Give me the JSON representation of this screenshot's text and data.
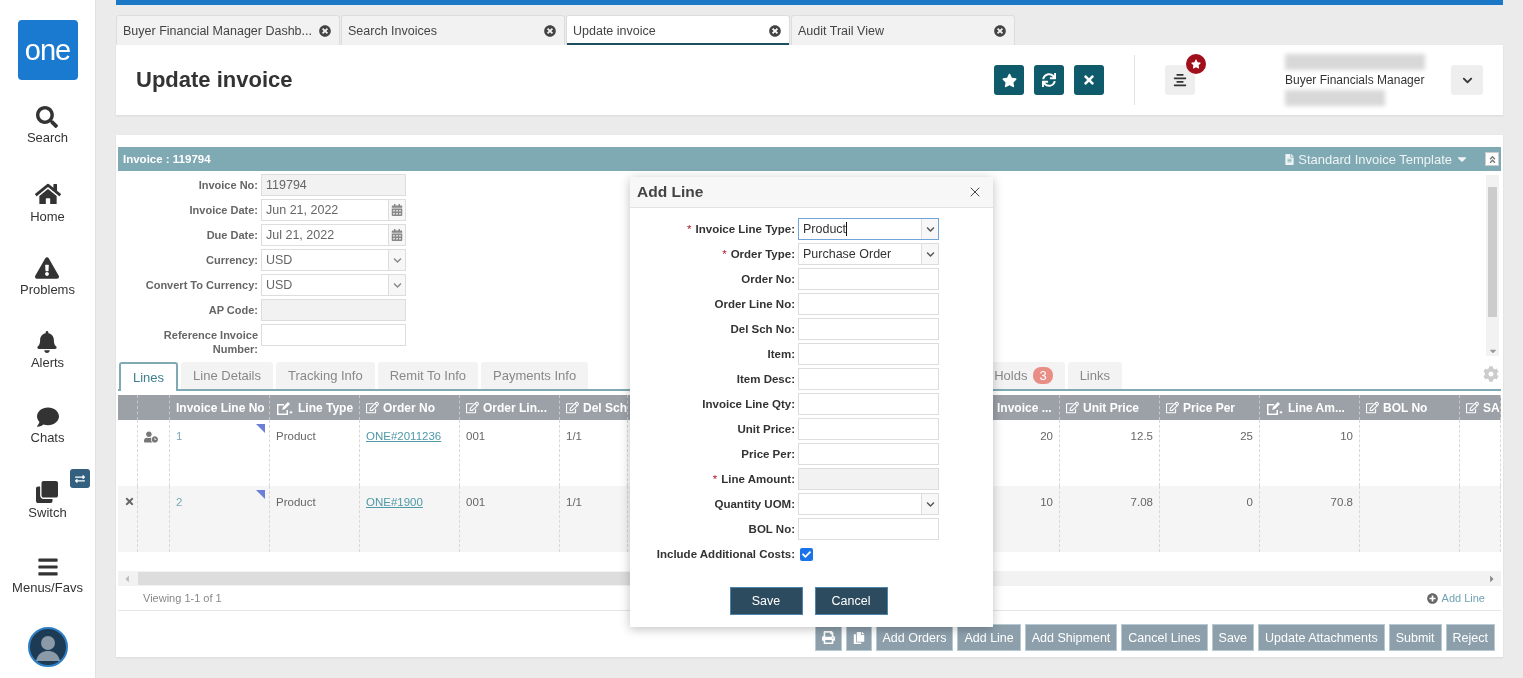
{
  "sidebar": {
    "logo": "one",
    "items": [
      {
        "label": "Search"
      },
      {
        "label": "Home"
      },
      {
        "label": "Problems"
      },
      {
        "label": "Alerts"
      },
      {
        "label": "Chats"
      },
      {
        "label": "Switch"
      },
      {
        "label": "Menus/Favs"
      }
    ]
  },
  "tabs": [
    {
      "label": "Buyer Financial Manager Dashb...",
      "selected": false
    },
    {
      "label": "Search Invoices",
      "selected": false
    },
    {
      "label": "Update invoice",
      "selected": true
    },
    {
      "label": "Audit Trail View",
      "selected": false
    }
  ],
  "header": {
    "title": "Update invoice",
    "role": "Buyer Financials Manager",
    "notification": true
  },
  "invoice": {
    "title": "Invoice : 119794",
    "template": "Standard Invoice Template",
    "fields": [
      {
        "label": "Invoice No:",
        "kind": "readonly",
        "value": "119794"
      },
      {
        "label": "Invoice Date:",
        "kind": "date",
        "value": "Jun 21, 2022"
      },
      {
        "label": "Due Date:",
        "kind": "date",
        "value": "Jul 21, 2022"
      },
      {
        "label": "Currency:",
        "kind": "select",
        "value": "USD"
      },
      {
        "label": "Convert To Currency:",
        "kind": "select",
        "value": "USD"
      },
      {
        "label": "AP Code:",
        "kind": "readonly"
      },
      {
        "label": "Reference Invoice Number:",
        "kind": "text"
      }
    ],
    "tabs": [
      {
        "label": "Lines",
        "selected": true
      },
      {
        "label": "Line Details",
        "selected": false
      },
      {
        "label": "Tracking Info",
        "selected": false
      },
      {
        "label": "Remit To Info",
        "selected": false
      },
      {
        "label": "Payments Info",
        "selected": false
      },
      {
        "label": "Holds",
        "count": "3",
        "selected": false
      },
      {
        "label": "Links",
        "selected": false
      }
    ],
    "table": {
      "columns": [
        {
          "label": "Invoice Line No",
          "kind": "line-no",
          "editable": false
        },
        {
          "label": "Line Type",
          "kind": "text",
          "editable": true,
          "required": true
        },
        {
          "label": "Order No",
          "kind": "link",
          "editable": true,
          "required": false
        },
        {
          "label": "Order Lin...",
          "kind": "text",
          "editable": true,
          "required": false
        },
        {
          "label": "Del Sch",
          "kind": "text",
          "editable": true,
          "required": false
        },
        {
          "label": "Invoice ...",
          "kind": "number",
          "editable": false
        },
        {
          "label": "Unit Price",
          "kind": "number",
          "editable": true,
          "required": false
        },
        {
          "label": "Price Per",
          "kind": "number",
          "editable": true,
          "required": false
        },
        {
          "label": "Line Am...",
          "kind": "number",
          "editable": true,
          "required": true
        },
        {
          "label": "BOL No",
          "kind": "text",
          "editable": true,
          "required": false
        },
        {
          "label": "SA",
          "kind": "text",
          "editable": true,
          "required": false
        }
      ],
      "rows": [
        {
          "kind": "history",
          "flagged": true,
          "cells": [
            "1",
            "Product",
            "ONE#2011236",
            "001",
            "1/1",
            "20",
            "12.5",
            "25",
            "10"
          ]
        },
        {
          "kind": "remove",
          "flagged": true,
          "cells": [
            "2",
            "Product",
            "ONE#1900",
            "001",
            "1/1",
            "10",
            "7.08",
            "0",
            "70.8"
          ]
        }
      ],
      "footer": "Viewing 1-1 of 1",
      "add_line": "Add Line"
    },
    "actions": [
      {
        "kind": "print"
      },
      {
        "kind": "copy"
      },
      {
        "kind": "text",
        "label": "Add Orders"
      },
      {
        "kind": "text",
        "label": "Add Line"
      },
      {
        "kind": "text",
        "label": "Add Shipment"
      },
      {
        "kind": "text",
        "label": "Cancel Lines"
      },
      {
        "kind": "text",
        "label": "Save"
      },
      {
        "kind": "text",
        "label": "Update Attachments"
      },
      {
        "kind": "text",
        "label": "Submit"
      },
      {
        "kind": "text",
        "label": "Reject"
      }
    ]
  },
  "dialog": {
    "title": "Add Line",
    "fields": [
      {
        "label": "Invoice Line Type:",
        "required_mark": "*",
        "kind": "select",
        "value": "Product",
        "focused": true
      },
      {
        "label": "Order Type:",
        "required_mark": "*",
        "kind": "select",
        "value": "Purchase Order",
        "focused": false
      },
      {
        "label": "Order No:",
        "kind": "text",
        "focused": false
      },
      {
        "label": "Order Line No:",
        "kind": "text",
        "focused": false
      },
      {
        "label": "Del Sch No:",
        "kind": "text",
        "focused": false
      },
      {
        "label": "Item:",
        "kind": "text",
        "focused": false
      },
      {
        "label": "Item Desc:",
        "kind": "text",
        "focused": false
      },
      {
        "label": "Invoice Line Qty:",
        "kind": "text",
        "focused": false
      },
      {
        "label": "Unit Price:",
        "kind": "text",
        "focused": false
      },
      {
        "label": "Price Per:",
        "kind": "text",
        "focused": false
      },
      {
        "label": "Line Amount:",
        "required_mark": "*",
        "kind": "readonly",
        "focused": false
      },
      {
        "label": "Quantity UOM:",
        "kind": "select",
        "focused": false
      },
      {
        "label": "BOL No:",
        "kind": "text",
        "focused": false
      }
    ],
    "include_costs": {
      "label": "Include Additional Costs:",
      "checked": true
    },
    "buttons": [
      "Save",
      "Cancel"
    ]
  }
}
